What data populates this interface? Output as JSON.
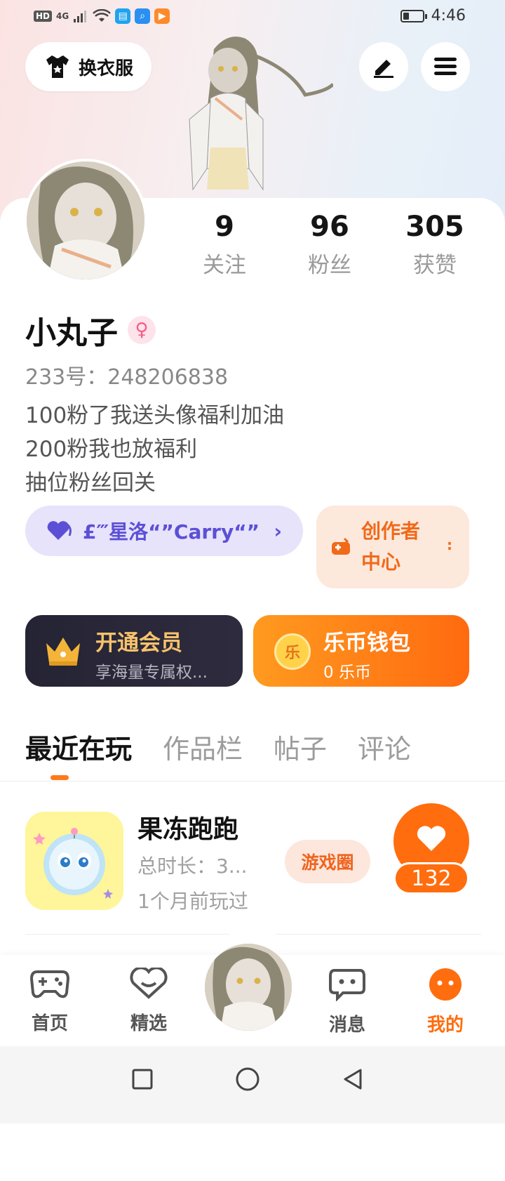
{
  "status_bar": {
    "hd": "HD",
    "network": "4G",
    "time": "4:46",
    "battery_level": 0.3
  },
  "header": {
    "outfit_label": "换衣服",
    "edit_icon": "edit-pen-icon",
    "menu_icon": "menu-icon"
  },
  "profile": {
    "stats": [
      {
        "value": "9",
        "label": "关注"
      },
      {
        "value": "96",
        "label": "粉丝"
      },
      {
        "value": "305",
        "label": "获赞"
      }
    ],
    "name": "小丸子",
    "gender_symbol": "♀",
    "uid": "233号：248206838",
    "bio": [
      "100粉了我送头像福利加油",
      "200粉我也放福利",
      "抽位粉丝回关"
    ]
  },
  "team": {
    "label": "£‴星洛“”Carry“”",
    "chevron": "›"
  },
  "creator": {
    "label": "创作者中心",
    "more": ":"
  },
  "vip": {
    "title": "开通会员",
    "subtitle": "享海量专属权..."
  },
  "wallet": {
    "title": "乐币钱包",
    "subtitle": "0 乐币",
    "coin_char": "乐"
  },
  "tabs": [
    {
      "label": "最近在玩",
      "active": true
    },
    {
      "label": "作品栏",
      "active": false
    },
    {
      "label": "帖子",
      "active": false
    },
    {
      "label": "评论",
      "active": false
    }
  ],
  "recent_game": {
    "name": "果冻跑跑",
    "duration": "总时长：3...",
    "last_played": "1个月前玩过",
    "circle_label": "游戏圈",
    "likes": "132"
  },
  "bottom_nav": [
    {
      "label": "首页",
      "icon": "gamepad-icon",
      "active": false
    },
    {
      "label": "精选",
      "icon": "heart-outline-icon",
      "active": false
    },
    {
      "label": "消息",
      "icon": "chat-bubble-icon",
      "active": false
    },
    {
      "label": "我的",
      "icon": "smile-icon",
      "active": true
    }
  ],
  "colors": {
    "accent": "#ff7a1a",
    "team_purple": "#5c4fd6",
    "vip_gold": "#f7c36b"
  }
}
